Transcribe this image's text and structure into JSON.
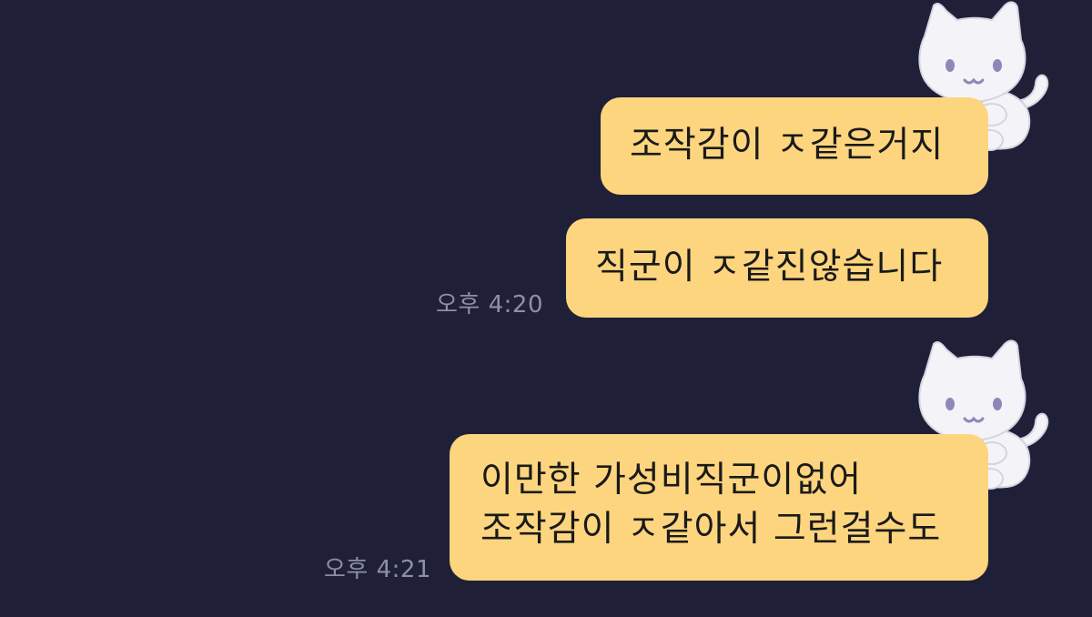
{
  "chat": {
    "messages": [
      {
        "lines": [
          "조작감이 ㅈ같은거지"
        ]
      },
      {
        "lines": [
          "직군이 ㅈ같진않습니다"
        ],
        "time": "오후 4:20"
      },
      {
        "lines": [
          "이만한 가성비직군이없어",
          "조작감이 ㅈ같아서 그런걸수도"
        ],
        "time": "오후 4:21"
      }
    ],
    "sticker_icon": "white-cat-sticker"
  },
  "colors": {
    "background": "#1f2038",
    "bubble": "#fdd57e",
    "timestamp": "#8d8fa6"
  }
}
